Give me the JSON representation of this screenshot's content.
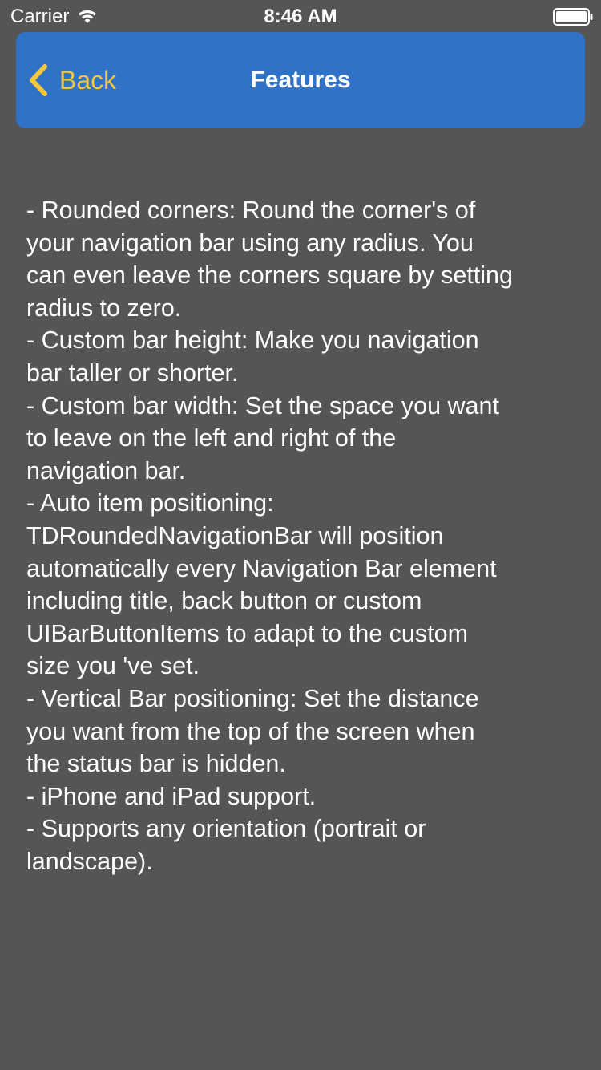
{
  "status_bar": {
    "carrier": "Carrier",
    "time": "8:46 AM"
  },
  "nav": {
    "back_label": "Back",
    "title": "Features",
    "bar_color": "#3072c6",
    "back_color": "#f5c73a"
  },
  "content": {
    "lines": [
      "- Rounded corners: Round the corner's of",
      "your navigation bar using any radius. You",
      "can even leave the corners square by setting",
      "radius to zero.",
      "- Custom bar height: Make you navigation",
      "bar taller or shorter.",
      "- Custom bar width: Set the space you want",
      "to leave on the left and right of the",
      "navigation bar.",
      "- Auto item positioning:",
      "TDRoundedNavigationBar will position",
      "automatically every Navigation Bar element",
      "including title, back button or custom",
      "UIBarButtonItems to adapt to the custom",
      "size you 've set.",
      "- Vertical Bar positioning: Set the distance",
      "you want from the top of the screen when",
      "the status bar is hidden.",
      "- iPhone and iPad support.",
      "- Supports any orientation (portrait or",
      "landscape)."
    ]
  }
}
